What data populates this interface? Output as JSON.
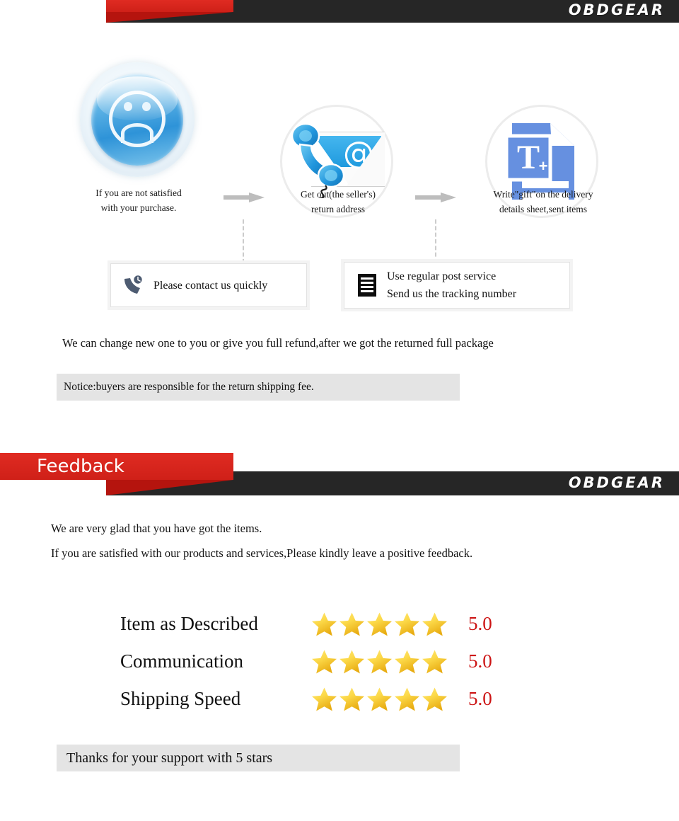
{
  "brand": {
    "name": "OBDGEAR"
  },
  "returns": {
    "steps": [
      {
        "icon": "sad-face-icon",
        "line1": "If you are not satisfied",
        "line2": "with your purchase."
      },
      {
        "icon": "phone-envelope-icon",
        "line1": "Get out(the seller's)",
        "line2": "return address"
      },
      {
        "icon": "document-text-icon",
        "line1": "Write\"gift\"on the delivery",
        "line2": "details sheet,sent items"
      }
    ],
    "boxes": [
      {
        "icon": "phone-clock-icon",
        "lines": [
          "Please contact us quickly"
        ]
      },
      {
        "icon": "document-lines-icon",
        "lines": [
          "Use regular post service",
          "Send us the tracking number"
        ]
      }
    ],
    "statement": "We can change new one to you or give you full refund,after we got the returned full package",
    "notice": "Notice:buyers are responsible for the return shipping fee."
  },
  "feedback": {
    "title": "Feedback",
    "line1": "We are very glad that you have got the items.",
    "line2": "If you are satisfied with our products and services,Please kindly leave a positive feedback.",
    "ratings": [
      {
        "label": "Item as Described",
        "stars": 5,
        "score": "5.0"
      },
      {
        "label": "Communication",
        "stars": 5,
        "score": "5.0"
      },
      {
        "label": "Shipping Speed",
        "stars": 5,
        "score": "5.0"
      }
    ],
    "thanks": "Thanks for your support with 5 stars"
  },
  "colors": {
    "brand_red": "#cf2018",
    "banner_dark": "#262626",
    "score_red": "#cc1414",
    "star_gold": "#f5c518",
    "box_gray": "#e4e4e4"
  }
}
